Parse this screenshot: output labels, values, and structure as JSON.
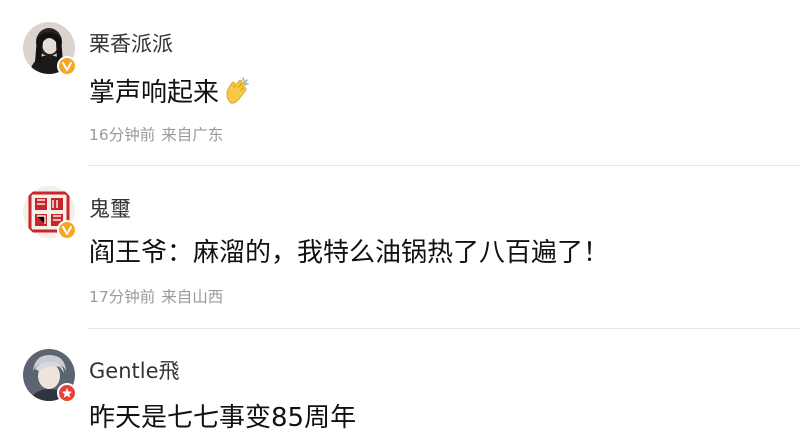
{
  "comments": [
    {
      "username": "栗香派派",
      "content": "掌声响起来",
      "emoji": "clapping-hands-icon",
      "time": "16分钟前",
      "location": "来自广东",
      "badge": "gold-verified-icon"
    },
    {
      "username": "鬼璽",
      "content": "阎王爷：麻溜的，我特么油锅热了八百遍了！",
      "time": "17分钟前",
      "location": "来自山西",
      "badge": "gold-verified-icon"
    },
    {
      "username": "Gentle飛",
      "content": "昨天是七七事变85周年",
      "badge": "red-verified-icon"
    }
  ],
  "colors": {
    "gold_badge": "#f5a623",
    "red_badge": "#e6423a",
    "meta": "#9a9a9a"
  }
}
